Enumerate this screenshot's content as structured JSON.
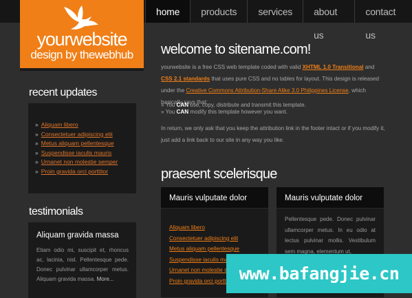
{
  "nav": {
    "items": [
      {
        "label": "home",
        "active": true
      },
      {
        "label": "products",
        "active": false
      },
      {
        "label": "services",
        "active": false
      },
      {
        "label": "about us",
        "active": false
      },
      {
        "label": "contact us",
        "active": false
      }
    ]
  },
  "logo": {
    "icon": "bird-icon",
    "title": "yourwebsite",
    "subtitle": "design by thewebhub",
    "color": "#f07f17"
  },
  "sidebar": {
    "recent_heading": "recent updates",
    "recent_items": [
      "Aliquam libero",
      "Consectetuer adipiscing elit",
      "Metus aliquam pellentesque",
      "Suspendisse iaculis mauris",
      "Urnanet non molestie semper",
      "Proin gravida orci porttitor"
    ],
    "testimonials_heading": "testimonials",
    "testimonial": {
      "title": "Aliquam gravida massa",
      "body": "Etiam odio mi, suscipit et, rhoncus ac, lacinia, nisl. Pellentesque pede. Donec pulvinar ullamcorper metus. Aliquam gravida massa.",
      "more": "More..."
    }
  },
  "main": {
    "welcome_heading": "welcome to sitename.com!",
    "intro": {
      "part1": "yourwebsite is a free CSS web template coded with valid ",
      "link1": "XHTML 1.0 Transitional",
      "part2": " and ",
      "link2": "CSS 2.1 standards",
      "part3": " that uses pure CSS and no tables for layout. This design is released under the ",
      "link3": "Creative Commons Attribution-Share Alike 3.0 Philippines License",
      "part4": ", which basically says that:"
    },
    "bullets": [
      {
        "prefix": "» You ",
        "strong": "CAN",
        "rest": " use, copy, distribute and transmit this template."
      },
      {
        "prefix": "» You ",
        "strong": "CAN",
        "rest": " modify this template however you want."
      }
    ],
    "return_text": "In return, we only ask that you keep the attribution link in the footer intact or if you modify it, just add a link back to our site in any way you like.",
    "section_heading": "praesent scelerisque",
    "boxes": [
      {
        "title": "Mauris vulputate dolor",
        "links": [
          "Aliquam libero",
          "Consectetuer adipiscing elit",
          "Metus aliquam pellentesque",
          "Suspendisse iaculis mauris",
          "Urnanet non molestie semper",
          "Proin gravida orci porttitor"
        ]
      },
      {
        "title": "Mauris vulputate dolor",
        "text": "Pellentesque pede. Donec pulvinar ullamcorper metus. In eu odio at lectus pulvinar mollis. Vestibulum sem magna, elementum ut,"
      }
    ]
  },
  "watermark": "www.bafangjie.cn"
}
